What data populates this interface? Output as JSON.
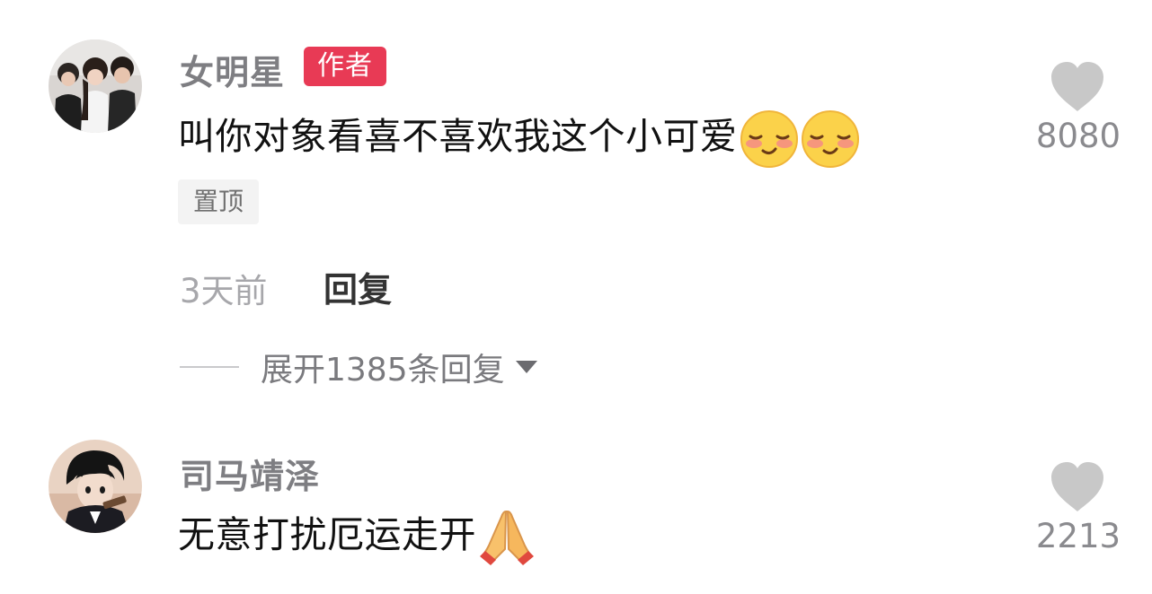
{
  "comments": [
    {
      "username": "女明星",
      "badge": "作者",
      "text": "叫你对象看喜不喜欢我这个小可爱",
      "emojis": [
        "blushing-face-emoji",
        "blushing-face-emoji"
      ],
      "pinned_label": "置顶",
      "time": "3天前",
      "reply_label": "回复",
      "expand_replies": "展开1385条回复",
      "likes": "8080"
    },
    {
      "username": "司马靖泽",
      "text": "无意打扰厄运走开",
      "emojis": [
        "folded-hands-emoji"
      ],
      "likes": "2213"
    }
  ],
  "colors": {
    "badge_bg": "#e83a55",
    "like_icon": "#c8c8c8",
    "username": "#7e7e82"
  }
}
